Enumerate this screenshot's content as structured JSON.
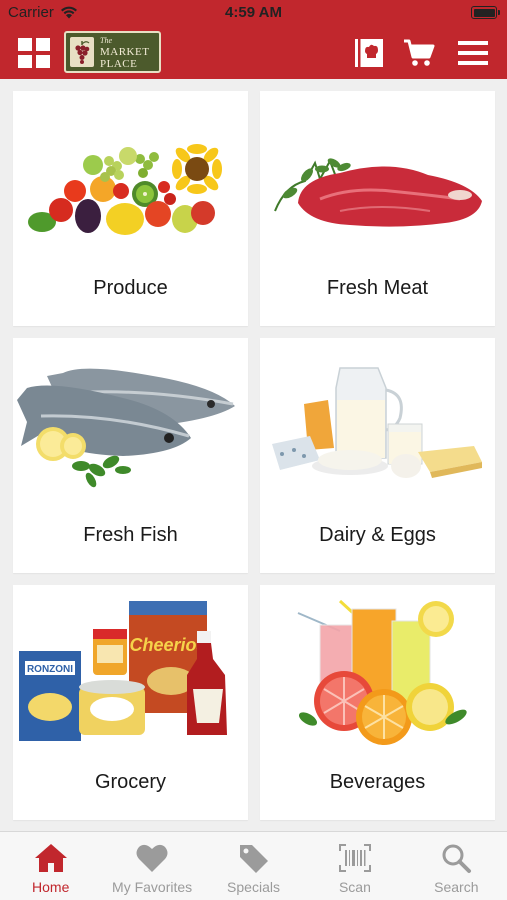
{
  "status_bar": {
    "carrier": "Carrier",
    "time": "4:59 AM",
    "icons": [
      "wifi-icon",
      "battery-icon"
    ]
  },
  "header": {
    "logo_small": "The",
    "logo_line1": "Market",
    "logo_line2": "Place",
    "icons": [
      "grid-menu-icon",
      "grapes-logo-icon",
      "recipe-card-icon",
      "cart-icon",
      "hamburger-menu-icon"
    ],
    "accent_color": "#c1272d"
  },
  "categories": [
    {
      "label": "Produce",
      "icon": "produce-image"
    },
    {
      "label": "Fresh Meat",
      "icon": "meat-image"
    },
    {
      "label": "Fresh Fish",
      "icon": "fish-image"
    },
    {
      "label": "Dairy & Eggs",
      "icon": "dairy-image"
    },
    {
      "label": "Grocery",
      "icon": "grocery-image"
    },
    {
      "label": "Beverages",
      "icon": "beverages-image"
    }
  ],
  "tabs": [
    {
      "label": "Home",
      "icon": "home-icon",
      "active": true
    },
    {
      "label": "My Favorites",
      "icon": "heart-icon",
      "active": false
    },
    {
      "label": "Specials",
      "icon": "tag-icon",
      "active": false
    },
    {
      "label": "Scan",
      "icon": "barcode-icon",
      "active": false
    },
    {
      "label": "Search",
      "icon": "search-icon",
      "active": false
    }
  ]
}
